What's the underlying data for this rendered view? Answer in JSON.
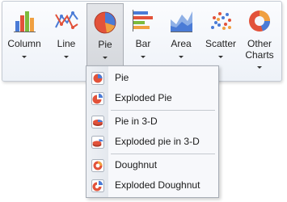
{
  "ribbon": {
    "buttons": [
      {
        "id": "column",
        "label": "Column"
      },
      {
        "id": "line",
        "label": "Line"
      },
      {
        "id": "pie",
        "label": "Pie"
      },
      {
        "id": "bar",
        "label": "Bar"
      },
      {
        "id": "area",
        "label": "Area"
      },
      {
        "id": "scatter",
        "label": "Scatter"
      },
      {
        "id": "other",
        "label": "Other",
        "label2": "Charts"
      }
    ],
    "active": "pie"
  },
  "menu": {
    "items": [
      {
        "label": "Pie",
        "icon": "pie-icon"
      },
      {
        "label": "Exploded Pie",
        "icon": "exploded-pie-icon"
      },
      {
        "label": "Pie in 3-D",
        "icon": "pie-3d-icon"
      },
      {
        "label": "Exploded pie in 3-D",
        "icon": "exploded-pie-3d-icon"
      },
      {
        "label": "Doughnut",
        "icon": "doughnut-icon"
      },
      {
        "label": "Exploded Doughnut",
        "icon": "exploded-doughnut-icon"
      }
    ]
  },
  "colors": {
    "accent_red": "#e2523a",
    "accent_blue": "#4a7bd6",
    "accent_orange": "#f0a040",
    "selected_bg": "#d3d6db"
  }
}
